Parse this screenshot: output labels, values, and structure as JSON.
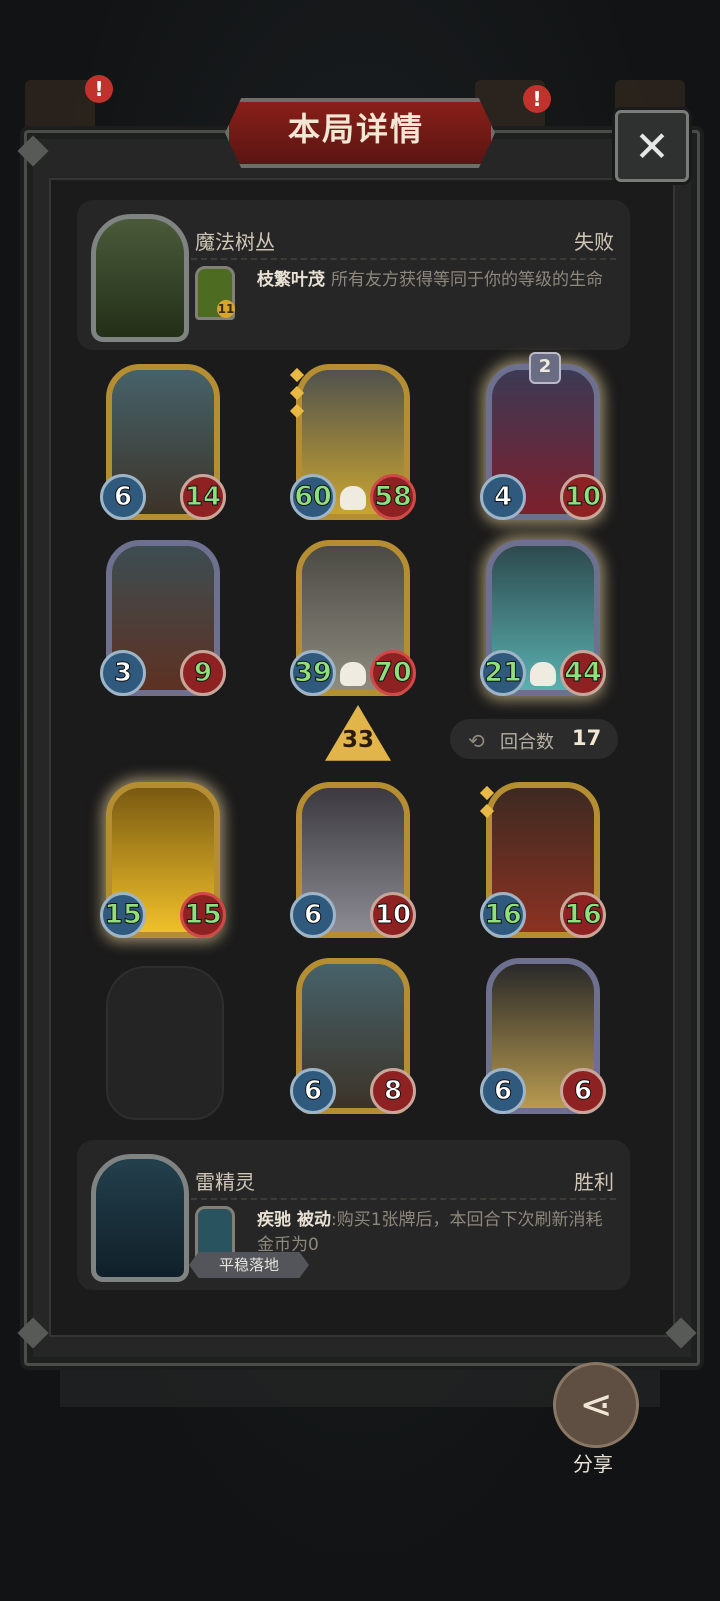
{
  "title": "本局详情",
  "close_icon": "close-icon",
  "opponent": {
    "name": "魔法树丛",
    "result": "失败",
    "skill_name": "枝繁叶茂",
    "skill_desc": "所有友方获得等同于你的等级的生命",
    "skill_level": "11"
  },
  "player": {
    "name": "雷精灵",
    "result": "胜利",
    "skill_name": "疾驰",
    "skill_type": "被动",
    "skill_desc": ":购买1张牌后，本回合下次刷新消耗金币为0",
    "tag": "平稳落地"
  },
  "opponent_cards": [
    {
      "atk": "6",
      "hp": "14"
    },
    {
      "atk": "60",
      "hp": "58"
    },
    {
      "atk": "4",
      "hp": "10",
      "level": "2"
    },
    {
      "atk": "3",
      "hp": "9"
    },
    {
      "atk": "39",
      "hp": "70"
    },
    {
      "atk": "21",
      "hp": "44"
    }
  ],
  "player_cards": [
    {
      "atk": "15",
      "hp": "15"
    },
    {
      "atk": "6",
      "hp": "10"
    },
    {
      "atk": "16",
      "hp": "16"
    },
    {
      "atk": "6",
      "hp": "8"
    },
    {
      "atk": "6",
      "hp": "6"
    }
  ],
  "damage": "33",
  "turns": {
    "label": "回合数",
    "value": "17"
  },
  "share_label": "分享",
  "colors": {
    "gold_frame": "#b58d32",
    "silver_frame": "#6e708f",
    "atk_blue": "#2f5a7e",
    "hp_red": "#8e2222",
    "buff_green": "#8ee07b"
  }
}
